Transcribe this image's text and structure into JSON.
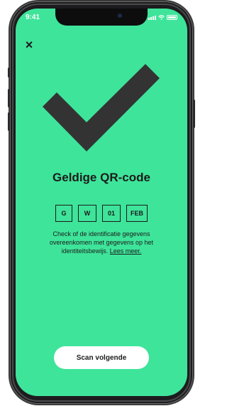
{
  "status_bar": {
    "time": "9:41",
    "icons": [
      "cellular-signal-icon",
      "wifi-icon",
      "battery-icon"
    ]
  },
  "header": {
    "close_label": "×",
    "close_icon": "close-icon"
  },
  "result": {
    "icon": "checkmark-icon",
    "title": "Geldige QR-code",
    "chips": [
      "G",
      "W",
      "01",
      "FEB"
    ],
    "description": "Check of de identificatie gegevens overeenkomen met gegevens op het identiteitsbewijs.",
    "link_label": "Lees meer."
  },
  "actions": {
    "scan_next_label": "Scan volgende"
  },
  "colors": {
    "background": "#3ee49a",
    "foreground": "#1b1b1b",
    "button_bg": "#ffffff"
  }
}
